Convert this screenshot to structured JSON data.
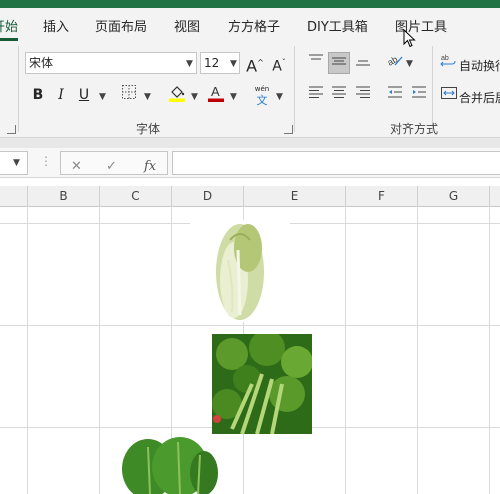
{
  "ribbon_tabs": [
    {
      "label": "开始",
      "active": true
    },
    {
      "label": "插入"
    },
    {
      "label": "页面布局"
    },
    {
      "label": "视图"
    },
    {
      "label": "方方格子"
    },
    {
      "label": "DIY工具箱"
    },
    {
      "label": "图片工具"
    }
  ],
  "font_group": {
    "font_name": "宋体",
    "font_size": "12",
    "grow_font_glyph": "A",
    "shrink_font_glyph": "A",
    "bold_glyph": "B",
    "italic_glyph": "I",
    "underline_glyph": "U",
    "wen_phonetic_top": "wén",
    "wen_phonetic_glyph": "文",
    "label": "字体"
  },
  "alignment_group": {
    "wrap_text_label": "自动换行",
    "merge_center_label": "合并后居中",
    "label": "对齐方式"
  },
  "formula_bar": {
    "fx_label": "fx",
    "formula": ""
  },
  "column_headers": [
    "B",
    "C",
    "D",
    "E",
    "F",
    "G"
  ],
  "images": [
    {
      "name": "chinese-cabbage-picture",
      "column": "D"
    },
    {
      "name": "celery-picture",
      "column": "E"
    },
    {
      "name": "choy-sum-picture",
      "column": "C"
    }
  ],
  "colors": {
    "excel_green": "#217346",
    "highlight_yellow": "#ffff00",
    "font_red": "#c00000"
  }
}
